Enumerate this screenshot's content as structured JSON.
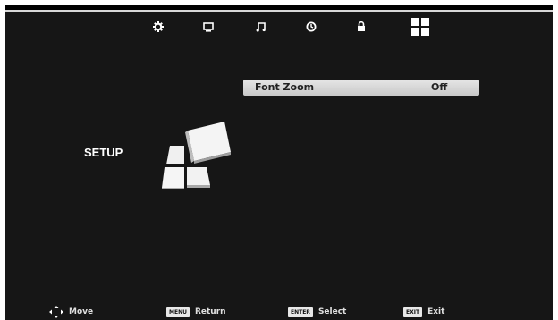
{
  "tabs": [
    {
      "name": "settings-icon"
    },
    {
      "name": "picture-icon"
    },
    {
      "name": "sound-icon"
    },
    {
      "name": "time-icon"
    },
    {
      "name": "lock-icon"
    },
    {
      "name": "setup-icon"
    }
  ],
  "menu": {
    "section_title": "SETUP",
    "items": [
      {
        "label": "Font Zoom",
        "value": "Off"
      }
    ]
  },
  "footer": {
    "move_label": "Move",
    "return_key": "MENU",
    "return_label": "Return",
    "select_key": "ENTER",
    "select_label": "Select",
    "exit_key": "EXIT",
    "exit_label": "Exit"
  },
  "colors": {
    "background": "#161616",
    "highlight_row": "#d9d9d9",
    "text": "#ffffff"
  }
}
